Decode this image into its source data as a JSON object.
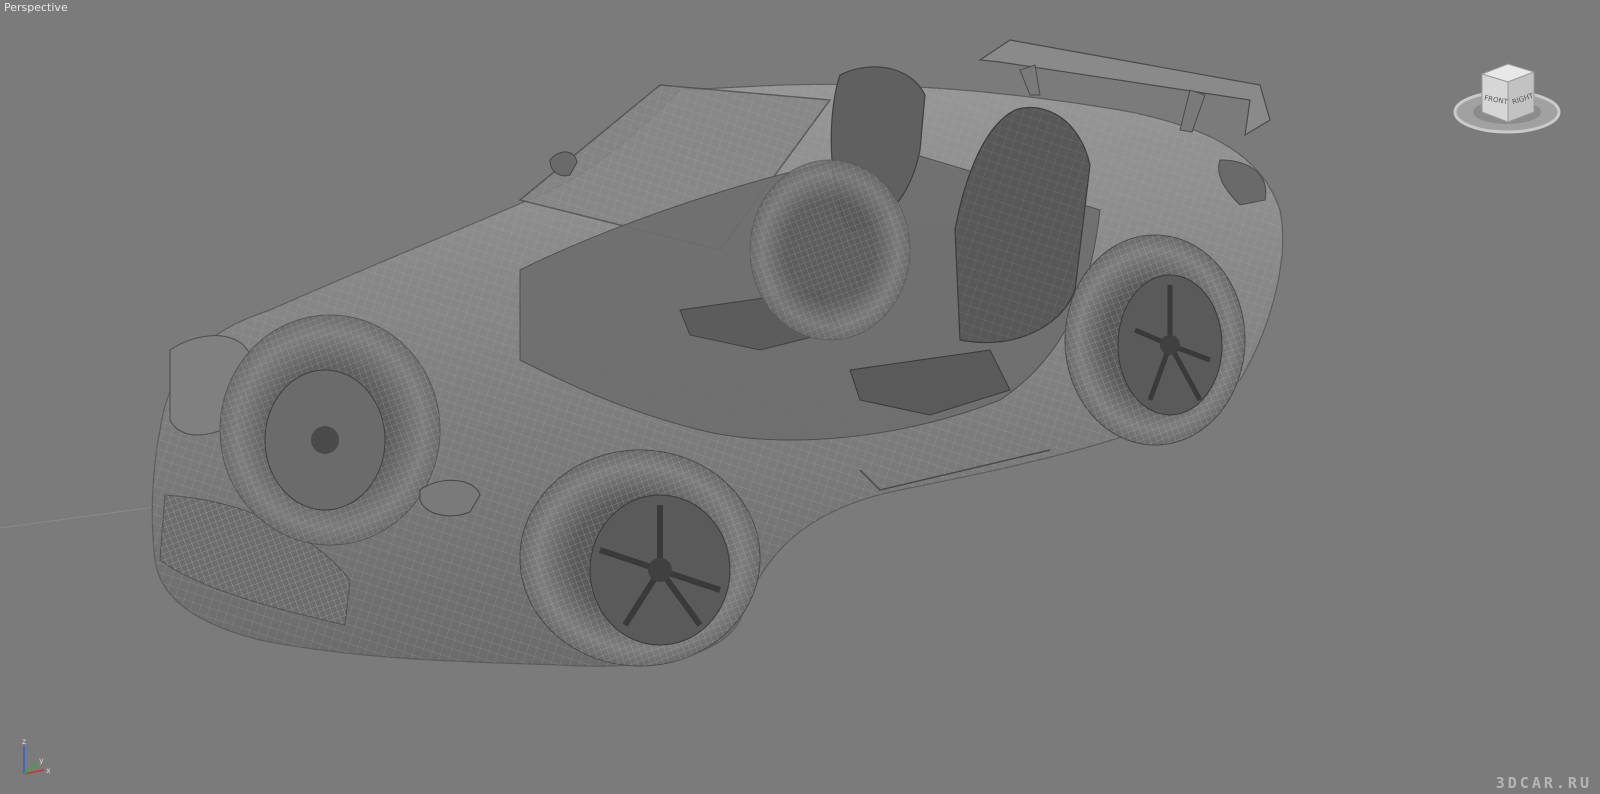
{
  "viewport": {
    "label": "Perspective",
    "background": "#7b7b7b"
  },
  "viewcube": {
    "faces": {
      "front": "FRONT",
      "right": "RIGHT"
    },
    "icon": "viewcube-icon"
  },
  "axes": {
    "z": "z",
    "x": "x",
    "y": "y",
    "colors": {
      "x": "#d03030",
      "y": "#30b030",
      "z": "#3060e0"
    }
  },
  "model": {
    "icon": "car-wireframe-model",
    "shade": "#8e8e8e",
    "wire": "#b8b8b8"
  },
  "watermark": {
    "text": "3DCAR.RU"
  }
}
